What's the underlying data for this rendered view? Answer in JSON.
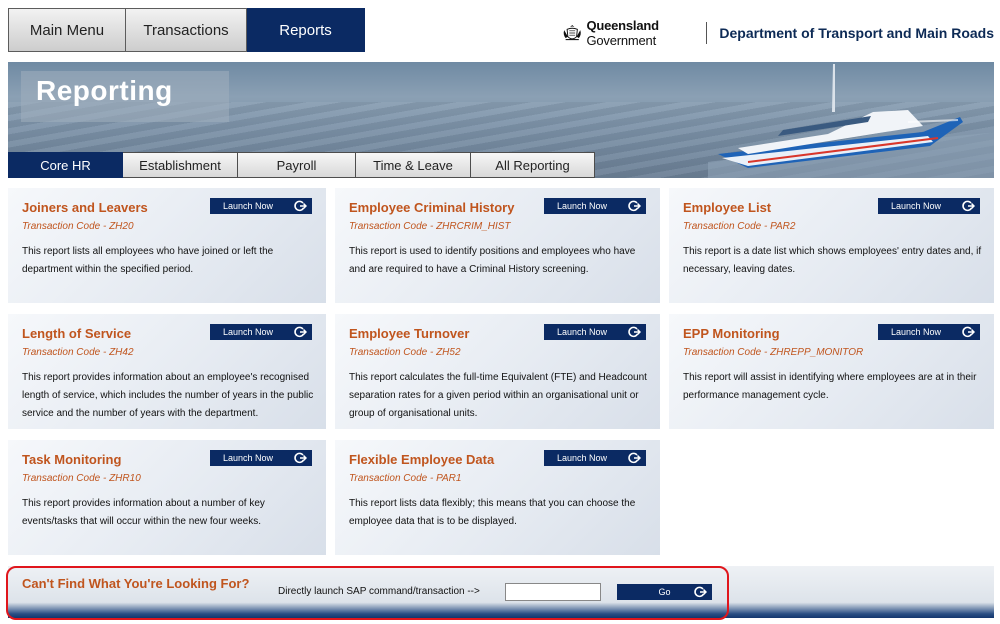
{
  "topnav": [
    "Main Menu",
    "Transactions",
    "Reports"
  ],
  "brand": {
    "qld_bold": "Queensland",
    "qld_rest": " Government",
    "dept": "Department of Transport and Main Roads"
  },
  "banner": {
    "title": "Reporting"
  },
  "subnav": [
    "Core HR",
    "Establishment",
    "Payroll",
    "Time & Leave",
    "All Reporting"
  ],
  "launch_label": "Launch Now",
  "cards": [
    {
      "title": "Joiners and Leavers",
      "code": "Transaction Code - ZH20",
      "desc": "This report lists all employees who have joined or left the department within the specified period."
    },
    {
      "title": "Employee Criminal History",
      "code": "Transaction Code - ZHRCRIM_HIST",
      "desc": "This report is used to identify positions and employees who have and are required to have a Criminal History screening."
    },
    {
      "title": "Employee List",
      "code": "Transaction Code - PAR2",
      "desc": "This report is a date list which shows employees' entry dates and, if necessary, leaving dates."
    },
    {
      "title": "Length of Service",
      "code": "Transaction Code - ZH42",
      "desc": "This report provides information about an employee's recognised length of service, which includes the number of years in the public service and the number of years with the department."
    },
    {
      "title": "Employee Turnover",
      "code": "Transaction Code - ZH52",
      "desc": "This report calculates the full-time Equivalent (FTE) and Headcount separation rates for a given period within an organisational unit or group of organisational units."
    },
    {
      "title": "EPP Monitoring",
      "code": "Transaction Code - ZHREPP_MONITOR",
      "desc": "This report will assist in identifying where employees are at in their performance management cycle."
    },
    {
      "title": "Task Monitoring",
      "code": "Transaction Code - ZHR10",
      "desc": "This report provides information about a number of key events/tasks that will occur within the new four weeks."
    },
    {
      "title": "Flexible Employee Data",
      "code": "Transaction Code - PAR1",
      "desc": "This report lists data flexibly; this means that you can choose the employee data that is to be displayed."
    }
  ],
  "bottom": {
    "title": "Can't Find What You're Looking For?",
    "label": "Directly launch SAP command/transaction -->",
    "input_value": "",
    "go_label": "Go"
  },
  "colors": {
    "accent": "#c0551e",
    "navy": "#0b2a63",
    "highlight": "#e0161c"
  }
}
